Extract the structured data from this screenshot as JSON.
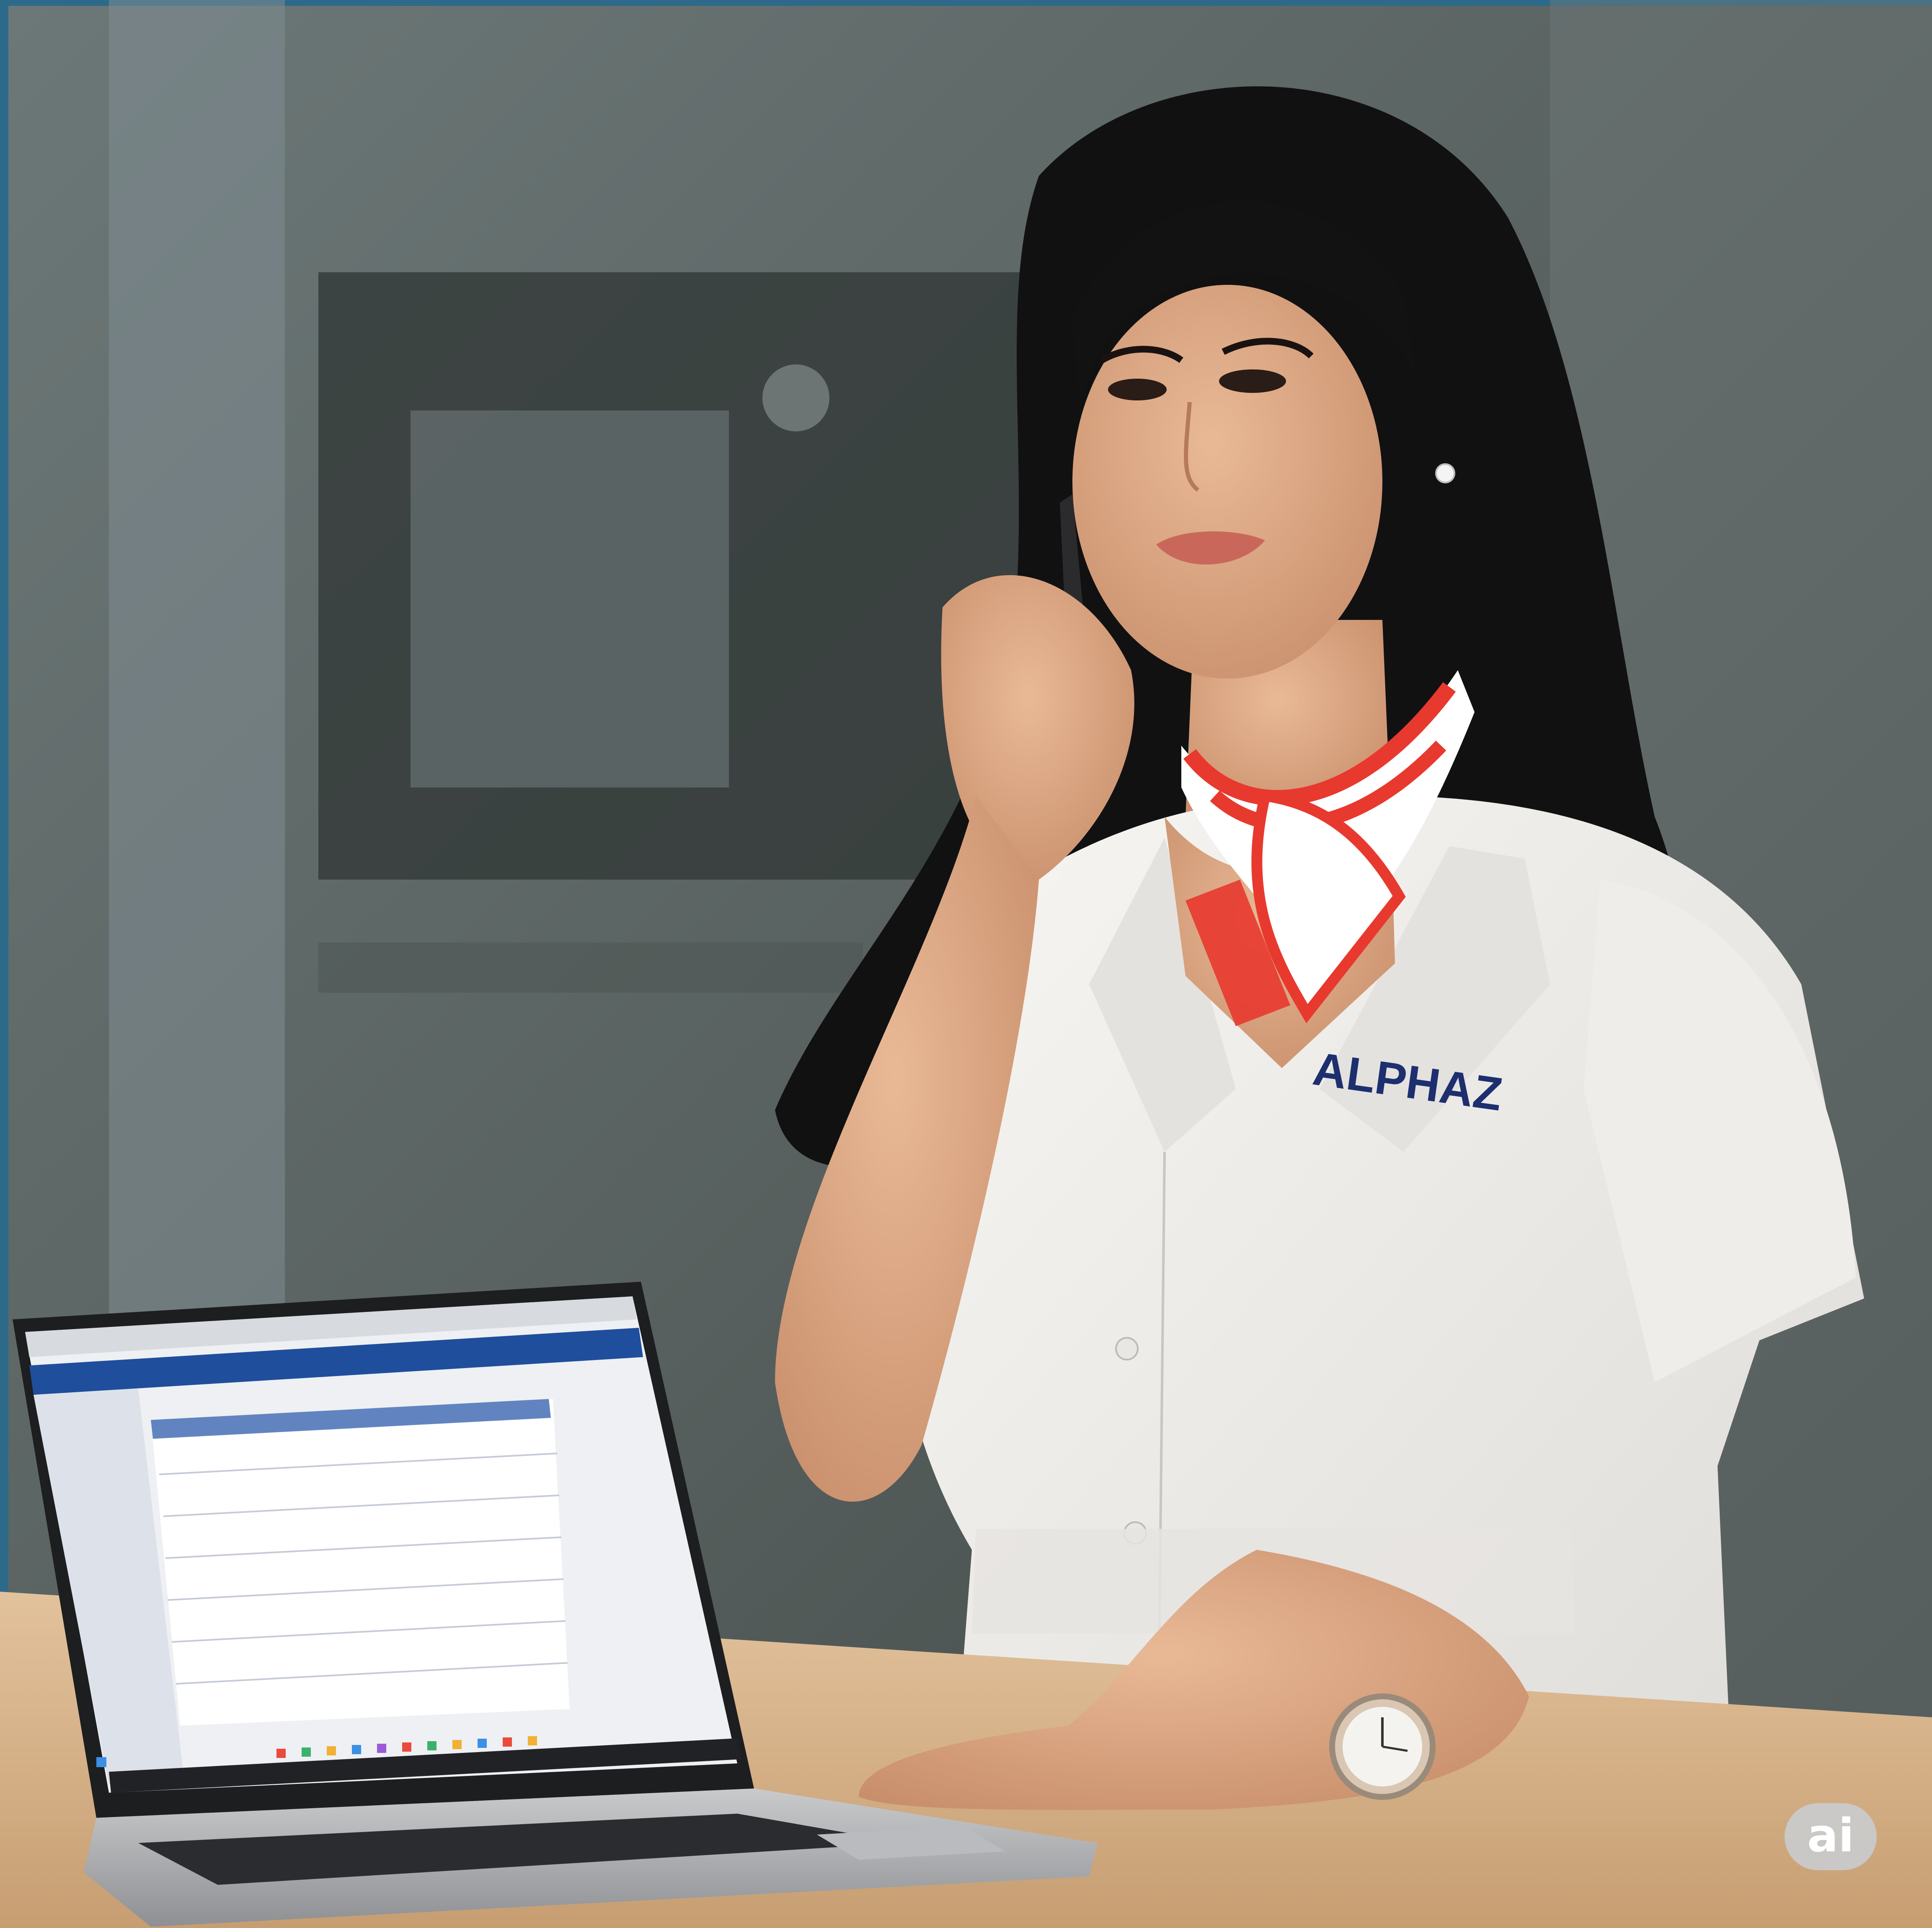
{
  "photo": {
    "uniform_brand": "ALPHAZ",
    "ai_badge": "ai"
  },
  "colors": {
    "brand_navy": "#1d2f6e",
    "scarf_red": "#e8392f",
    "uniform_white": "#f2f1ee",
    "ui_blue": "#1f4e9c",
    "desk_wood": "#d9b58c",
    "background_grey": "#5f6a6a"
  },
  "icons": [
    "windows-start-icon",
    "taskbar-app-icons",
    "wristwatch",
    "smartphone",
    "ai-badge-icon"
  ]
}
